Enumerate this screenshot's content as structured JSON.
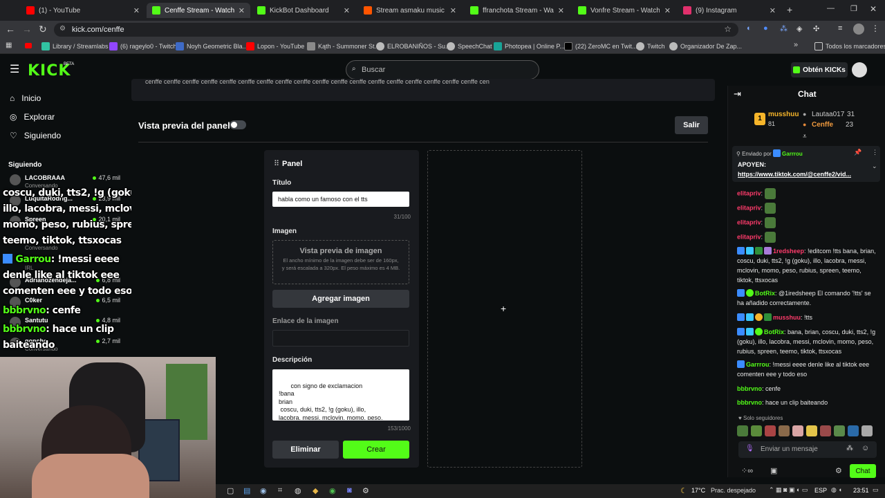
{
  "tabs": [
    {
      "title": "(1) - YouTube",
      "color": "#ff0000"
    },
    {
      "title": "Cenffe Stream - Watch Live on Kick",
      "color": "#53fc18"
    },
    {
      "title": "KickBot Dashboard",
      "color": "#53fc18"
    },
    {
      "title": "Stream asmaku music | Listen",
      "color": "#ff5500"
    },
    {
      "title": "ffranchota Stream - Watch",
      "color": "#53fc18"
    },
    {
      "title": "Vonfre Stream - Watch Live",
      "color": "#53fc18"
    },
    {
      "title": "(9) Instagram",
      "color": "#e1306c"
    }
  ],
  "address": {
    "url": "kick.com/cenffe"
  },
  "bookmarks": [
    "Library / Streamlabs",
    "(6) rageylo0 - Twitch",
    "Noyh Geometric Bla...",
    "Lopon - YouTube",
    "Kąth - Summoner St...",
    "ELROBANIÑOS - Su...",
    "SpeechChat",
    "Photopea | Online P...",
    "(22) ZeroMC en Twit...",
    "Twitch",
    "Organizador De Zap...",
    "Todos los marcadores"
  ],
  "header": {
    "logo": "KICK",
    "beta": "BETA",
    "search_placeholder": "Buscar",
    "get_kicks": "Obtén KICKs"
  },
  "sidebar": {
    "nav": [
      "Inicio",
      "Explorar",
      "Siguiendo"
    ],
    "following_title": "Siguiendo",
    "channels": [
      {
        "name": "LACOBRAAA",
        "viewers": "47,6 mil",
        "category": "Conversando"
      },
      {
        "name": "LuquitaRodrig...",
        "viewers": "23,9 mil",
        "category": ""
      },
      {
        "name": "Spreen",
        "viewers": "20,1 mil",
        "category": ""
      },
      {
        "name": "",
        "viewers": "",
        "category": "Conversando"
      },
      {
        "name": "",
        "viewers": "",
        "category": "IRL"
      },
      {
        "name": "Adrianozendeja...",
        "viewers": "6,8 mil",
        "category": ""
      },
      {
        "name": "C0ker",
        "viewers": "6,5 mil",
        "category": ""
      },
      {
        "name": "Santutu",
        "viewers": "4,8 mil",
        "category": ""
      },
      {
        "name": "goncho",
        "viewers": "2,7 mil",
        "category": "Conversando"
      }
    ]
  },
  "overlay": {
    "lines": [
      "coscu, duki, tts2, !g (goku),",
      "illo, lacobra, messi, mclovin,",
      "momo, peso, rubius, spreen,",
      "teemo, tiktok, ttsxocas"
    ],
    "msg1_user": "Garrou",
    "msg1_lines": [
      ": !messi eeee",
      "denle like al tiktok eee",
      "comenten eee y todo eso"
    ],
    "msg2_user": "bbbrvno",
    "msg2_text": ": cenfe",
    "msg3_user": "bbbrvno",
    "msg3_lines": [
      ": hace un clip",
      "baiteando"
    ]
  },
  "top_text": "cenffe cenffe cenffe cenffe cenffe cenffe cenffe cenffe cenffe cenffe cenffe cenffe cenffe cenffe cenffe cenffe cenffe cenffe cen",
  "panel_preview": {
    "label": "Vista previa del panel",
    "exit": "Salir"
  },
  "panel_form": {
    "heading": "Panel",
    "title_label": "Título",
    "title_value": "habla como un famoso con el tts",
    "title_count": "31/100",
    "image_label": "Imagen",
    "image_preview_title": "Vista previa de imagen",
    "image_preview_desc": "El ancho mínimo de la imagen debe ser de 160px, y será escalada a 320px. El peso máximo es 4 MB.",
    "add_image": "Agregar imagen",
    "link_label": "Enlace de la imagen",
    "link_value": "",
    "description_label": "Descripción",
    "description_value": " con signo de exclamacion\n!bana\nbrian\n coscu, duki, tts2, !g (goku), illo,\nlacobra, messi, mclovin, momo, peso,\nrubius, spreen, teemo, tiktok, ttsxocas",
    "description_count": "153/1000",
    "delete": "Eliminar",
    "create": "Crear",
    "add_panel_symbol": "+"
  },
  "chat": {
    "title": "Chat",
    "leaders": [
      {
        "rank": "1",
        "name": "musshuu",
        "value": "81"
      },
      {
        "name": "Lautaa017",
        "value": "31"
      },
      {
        "name": "Cenffe",
        "value": "23"
      }
    ],
    "pinned_by_label": "Enviado por",
    "pinned_by_user": "Garrrou",
    "pinned_text": "APOYEN:",
    "pinned_link": "https://www.tiktok.com/@cenffe2/vid...",
    "emote_users": [
      "elitapriv",
      "elitapriv",
      "elitapriv",
      "elitapriv"
    ],
    "messages": [
      {
        "user": "1redsheep",
        "color": "#ff3b6b",
        "text": ": !editcom !tts bana, brian, coscu, duki, tts2, !g (goku), illo, lacobra, messi, mclovin, momo, peso, rubius, spreen, teemo, tiktok, ttsxocas"
      },
      {
        "user": "BotRix",
        "color": "#53fc18",
        "text": ": @1iredsheep El comando '!tts' se ha añadido correctamente."
      },
      {
        "user": "musshuu",
        "color": "#ff3b6b",
        "text": ": !tts"
      },
      {
        "user": "BotRix",
        "color": "#53fc18",
        "text": ": bana, brian, coscu, duki, tts2, !g (goku), illo, lacobra, messi, mclovin, momo, peso, rubius, spreen, teemo, tiktok, ttsxocas"
      },
      {
        "user": "Garrrou",
        "color": "#53fc18",
        "text": ": !messi eeee denle like al tiktok eee comenten eee y todo eso"
      },
      {
        "user": "bbbrvno",
        "color": "#53fc18",
        "text": ": cenfe"
      },
      {
        "user": "bbbrvno",
        "color": "#53fc18",
        "text": ": hace un clip baiteando"
      }
    ],
    "followers_only": "Solo seguidores",
    "input_placeholder": "Enviar un mensaje",
    "send": "Chat"
  },
  "taskbar": {
    "weather": "17°C",
    "weather_desc": "Prac. despejado",
    "lang": "ESP",
    "time": "23:51"
  },
  "colors": {
    "kick_green": "#53fc18",
    "bg": "#0b0e0f"
  }
}
